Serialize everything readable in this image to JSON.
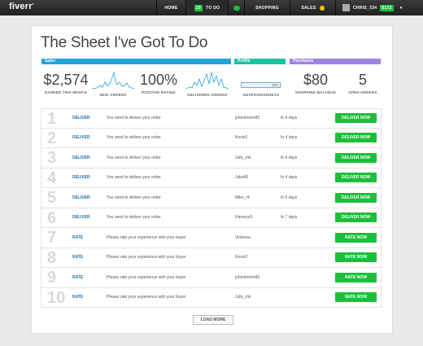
{
  "topbar": {
    "logo": "fiverr",
    "nav": {
      "home": "HOME",
      "todo_badge": "10",
      "todo": "TO DO",
      "shopping": "SHOPPING",
      "sales": "SALES",
      "user_name": "CHRIS_334",
      "balance": "$172"
    }
  },
  "page": {
    "title": "The Sheet I've Got To Do",
    "sections": {
      "sales": "Sales",
      "profile": "Profile",
      "purchases": "Purchases"
    },
    "stats": {
      "earned_value": "$2,574",
      "earned_label": "EARNED THIS MONTH",
      "new_orders_label": "NEW ORDERS",
      "rating_value": "100%",
      "rating_label": "POSITIVE RATING",
      "delivered_label": "DELIVERED ORDERS",
      "responsiveness_value": "N/A",
      "responsiveness_label": "RESPONSIVENESS",
      "shopping_value": "$80",
      "shopping_label": "SHOPPING BALANCE",
      "open_value": "5",
      "open_label": "OPEN ORDERS"
    },
    "rows": [
      {
        "num": "1",
        "type": "DELIVER",
        "text": "You need to deliver your order",
        "buyer": "johnnlmom83",
        "due": "In 4 days",
        "action": "DELIVER NOW"
      },
      {
        "num": "2",
        "type": "DELIVER",
        "text": "You need to deliver your order",
        "buyer": "Kevin2",
        "due": "In 4 days",
        "action": "DELIVER NOW"
      },
      {
        "num": "3",
        "type": "DELIVER",
        "text": "You need to deliver your order",
        "buyer": "Jully_mk",
        "due": "In 4 days",
        "action": "DELIVER NOW"
      },
      {
        "num": "4",
        "type": "DELIVER",
        "text": "You need to deliver your order",
        "buyer": "Jake45",
        "due": "In 4 days",
        "action": "DELIVER NOW"
      },
      {
        "num": "5",
        "type": "DELIVER",
        "text": "You need to deliver your order",
        "buyer": "Mike_r4",
        "due": "In 5 days",
        "action": "DELIVER NOW"
      },
      {
        "num": "6",
        "type": "DELIVER",
        "text": "You need to deliver your order",
        "buyer": "Harveys3",
        "due": "In 7 days",
        "action": "DELIVER NOW"
      },
      {
        "num": "7",
        "type": "RATE",
        "text": "Please rate your experience with your buyer",
        "buyer": "Viniessa",
        "due": "",
        "action": "RATE NOW"
      },
      {
        "num": "8",
        "type": "RATE",
        "text": "Please rate your experience with your buyer",
        "buyer": "Kevin2",
        "due": "",
        "action": "RATE NOW"
      },
      {
        "num": "9",
        "type": "RATE",
        "text": "Please rate your experience with your buyer",
        "buyer": "johnnlmom83",
        "due": "",
        "action": "RATE NOW"
      },
      {
        "num": "10",
        "type": "RATE",
        "text": "Please rate your experience with your buyer",
        "buyer": "Jully_mk",
        "due": "",
        "action": "RATE NOW"
      }
    ],
    "load_more": "LOAD MORE"
  },
  "colors": {
    "accent_green": "#1dbf3a",
    "sales_blue": "#23a4d8",
    "profile_teal": "#1bc3a2",
    "purchases_purple": "#9d83e0"
  },
  "icons": {
    "message": "message-bubble-icon",
    "sales": "coin-icon",
    "user": "avatar-icon",
    "caret": "chevron-down-icon"
  }
}
